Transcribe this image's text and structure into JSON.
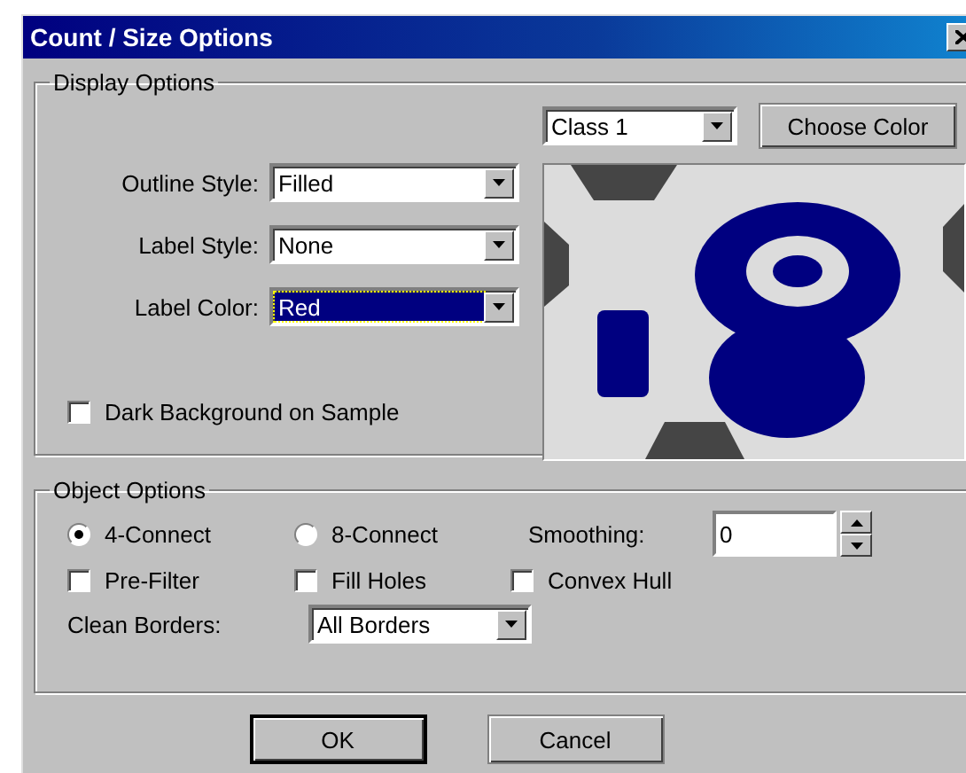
{
  "window": {
    "title": "Count / Size Options"
  },
  "display_options": {
    "title": "Display Options",
    "fields": [
      {
        "label": "Outline Style:",
        "value": "Filled",
        "focused": false
      },
      {
        "label": "Label Style:",
        "value": "None",
        "focused": false
      },
      {
        "label": "Label Color:",
        "value": "Red",
        "focused": true
      }
    ],
    "dark_background": {
      "label": "Dark Background on Sample",
      "checked": false
    },
    "class_select": {
      "value": "Class 1"
    },
    "choose_color_button": "Choose Color"
  },
  "object_options": {
    "title": "Object Options",
    "connectivity": [
      {
        "label": "4-Connect",
        "selected": true
      },
      {
        "label": "8-Connect",
        "selected": false
      }
    ],
    "smoothing": {
      "label": "Smoothing:",
      "value": "0"
    },
    "checkboxes": [
      {
        "label": "Pre-Filter",
        "checked": false
      },
      {
        "label": "Fill Holes",
        "checked": false
      },
      {
        "label": "Convex Hull",
        "checked": false
      }
    ],
    "clean_borders": {
      "label": "Clean Borders:",
      "value": "All Borders"
    }
  },
  "buttons": [
    {
      "label": "OK",
      "default": true
    },
    {
      "label": "Cancel",
      "default": false
    }
  ]
}
